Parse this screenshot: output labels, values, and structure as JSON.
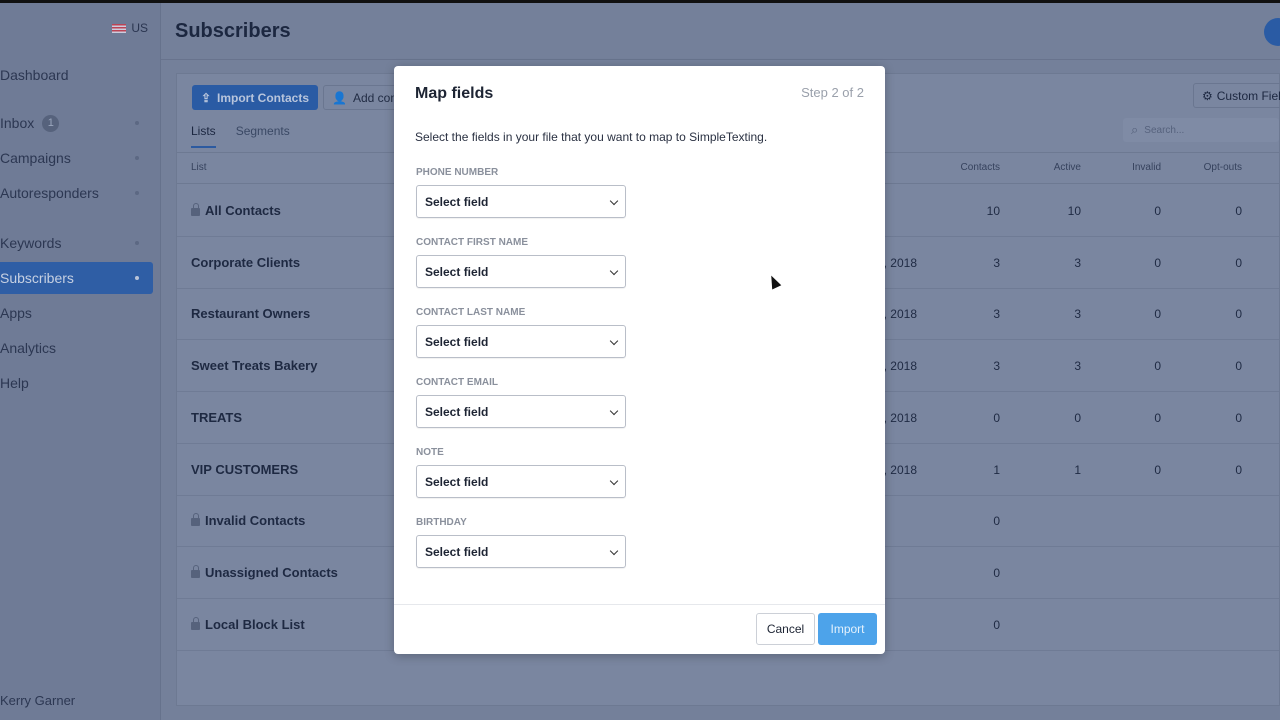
{
  "sidebar": {
    "locale": "US",
    "items": [
      {
        "label": "Dashboard",
        "dot": false
      },
      {
        "label": "Inbox",
        "badge": "1",
        "dot": true
      },
      {
        "label": "Campaigns",
        "dot": true
      },
      {
        "label": "Autoresponders",
        "dot": true
      },
      {
        "label": "Keywords",
        "dot": true
      },
      {
        "label": "Subscribers",
        "dot": true,
        "active": true
      },
      {
        "label": "Apps",
        "dot": false
      },
      {
        "label": "Analytics",
        "dot": false
      },
      {
        "label": "Help",
        "dot": false
      }
    ],
    "user": "Kerry Garner"
  },
  "header": {
    "title": "Subscribers"
  },
  "toolbar": {
    "import": "Import Contacts",
    "add": "Add contact",
    "custom_fields": "Custom Fields",
    "search_placeholder": "Search..."
  },
  "tabs": [
    "Lists",
    "Segments"
  ],
  "table": {
    "columns": [
      "List",
      "Contacts",
      "Active",
      "Invalid",
      "Opt-outs"
    ],
    "rows": [
      {
        "name": "All Contacts",
        "locked": true,
        "date": "",
        "contacts": "10",
        "active": "10",
        "invalid": "0",
        "optouts": "0"
      },
      {
        "name": "Corporate Clients",
        "locked": false,
        "date": ", 2018",
        "contacts": "3",
        "active": "3",
        "invalid": "0",
        "optouts": "0"
      },
      {
        "name": "Restaurant Owners",
        "locked": false,
        "date": ", 2018",
        "contacts": "3",
        "active": "3",
        "invalid": "0",
        "optouts": "0"
      },
      {
        "name": "Sweet Treats Bakery",
        "locked": false,
        "date": ", 2018",
        "contacts": "3",
        "active": "3",
        "invalid": "0",
        "optouts": "0"
      },
      {
        "name": "TREATS",
        "locked": false,
        "date": ", 2018",
        "contacts": "0",
        "active": "0",
        "invalid": "0",
        "optouts": "0"
      },
      {
        "name": "VIP CUSTOMERS",
        "locked": false,
        "date": ", 2018",
        "contacts": "1",
        "active": "1",
        "invalid": "0",
        "optouts": "0"
      },
      {
        "name": "Invalid Contacts",
        "locked": true,
        "date": "",
        "contacts": "0",
        "active": "",
        "invalid": "",
        "optouts": ""
      },
      {
        "name": "Unassigned Contacts",
        "locked": true,
        "date": "",
        "contacts": "0",
        "active": "",
        "invalid": "",
        "optouts": ""
      },
      {
        "name": "Local Block List",
        "locked": true,
        "date": "",
        "contacts": "0",
        "active": "",
        "invalid": "",
        "optouts": ""
      }
    ]
  },
  "modal": {
    "title": "Map fields",
    "step": "Step 2 of 2",
    "description": "Select the fields in your file that you want to map to SimpleTexting.",
    "fields": [
      {
        "label": "Phone Number",
        "value": "Select field"
      },
      {
        "label": "Contact First Name",
        "value": "Select field"
      },
      {
        "label": "Contact Last Name",
        "value": "Select field"
      },
      {
        "label": "Contact Email",
        "value": "Select field"
      },
      {
        "label": "Note",
        "value": "Select field"
      },
      {
        "label": "Birthday",
        "value": "Select field"
      }
    ],
    "cancel": "Cancel",
    "import": "Import"
  },
  "colors": {
    "primary": "#2a5ba4",
    "import_button": "#4da3ea"
  }
}
